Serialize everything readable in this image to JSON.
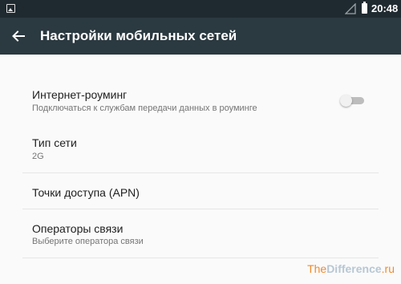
{
  "status_bar": {
    "time": "20:48",
    "left_icon": "image-notification-icon",
    "signal_icon": "signal-empty-icon",
    "battery_icon": "battery-full-icon"
  },
  "app_bar": {
    "title": "Настройки мобильных сетей",
    "back_icon": "arrow-back-icon"
  },
  "settings": {
    "roaming": {
      "title": "Интернет-роуминг",
      "subtitle": "Подключаться к службам передачи данных в роуминге",
      "toggle_on": false
    },
    "network_type": {
      "title": "Тип сети",
      "subtitle": "2G"
    },
    "apn": {
      "title": "Точки доступа (APN)"
    },
    "operators": {
      "title": "Операторы связи",
      "subtitle": "Выберите оператора связи"
    }
  },
  "watermark": {
    "part1": "The",
    "part2": "Difference",
    "part3": ".ru"
  },
  "colors": {
    "status_bar": "#1f2a30",
    "app_bar": "#2b3940",
    "background": "#fafafa",
    "toggle_off_track": "#bdbdbd"
  }
}
